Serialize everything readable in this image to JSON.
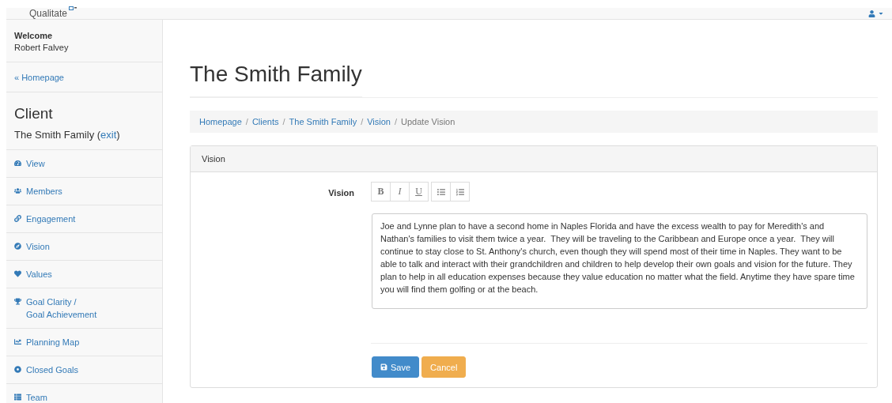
{
  "navbar": {
    "brand": "Qualitate"
  },
  "sidebar": {
    "welcome_title": "Welcome",
    "user_name": "Robert Falvey",
    "back_link": "« Homepage",
    "section_title": "Client",
    "client_name": "The Smith Family (",
    "exit_link": "exit",
    "client_suffix": ")",
    "items": [
      {
        "label": "View"
      },
      {
        "label": "Members"
      },
      {
        "label": "Engagement"
      },
      {
        "label": "Vision"
      },
      {
        "label": "Values"
      },
      {
        "label": "Goal Clarity /\nGoal Achievement"
      },
      {
        "label": "Planning Map"
      },
      {
        "label": "Closed Goals"
      },
      {
        "label": "Team"
      }
    ]
  },
  "page_title": "The Smith Family",
  "breadcrumb_separator": "/",
  "breadcrumb": [
    {
      "label": "Homepage",
      "kind": "link"
    },
    {
      "label": "Clients",
      "kind": "link"
    },
    {
      "label": "The Smith Family",
      "kind": "link"
    },
    {
      "label": "Vision",
      "kind": "link"
    },
    {
      "label": "Update Vision",
      "kind": "current"
    }
  ],
  "panel": {
    "title": "Vision",
    "field_label": "Vision",
    "toolbar": [
      {
        "kind": "char",
        "label": "B"
      },
      {
        "kind": "char",
        "label": "I"
      },
      {
        "kind": "char",
        "label": "U"
      },
      {
        "kind": "bullets"
      },
      {
        "kind": "numbers"
      }
    ],
    "text": "Joe and Lynne plan to have a second home in Naples Florida and have the excess wealth to pay for Meredith's and Nathan's families to visit them twice a year.  They will be traveling to the Caribbean and Europe once a year.  They will continue to stay close to St. Anthony's church, even though they will spend most of their time in Naples. They want to be able to talk and interact with their grandchildren and children to help develop their own goals and vision for the future. They plan to help in all education expenses because they value education no matter what the field. Anytime they have spare time you will find them golfing or at the beach.",
    "buttons": [
      {
        "kind": "primary",
        "label": "Save"
      },
      {
        "kind": "warning",
        "label": "Cancel"
      }
    ]
  }
}
